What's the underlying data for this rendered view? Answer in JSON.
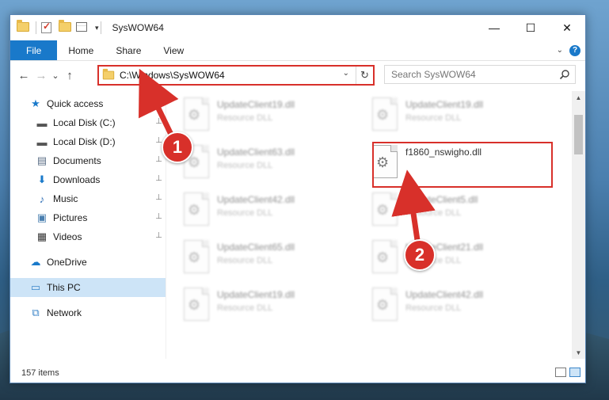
{
  "window": {
    "title": "SysWOW64",
    "controls": {
      "minimize": "—",
      "maximize": "☐",
      "close": "✕"
    }
  },
  "ribbon": {
    "tabs": [
      {
        "label": "File",
        "active": true
      },
      {
        "label": "Home"
      },
      {
        "label": "Share"
      },
      {
        "label": "View"
      }
    ],
    "accent": "#1979ca"
  },
  "navigation": {
    "back": "←",
    "forward": "→",
    "recent": "⌄",
    "up": "↑"
  },
  "address": {
    "path": "C:\\Windows\\SysWOW64",
    "dropdown": "⌄",
    "refresh": "↻"
  },
  "search": {
    "placeholder": "Search SysWOW64"
  },
  "sidebar": {
    "items": [
      {
        "label": "Quick access",
        "icon": "star-icon",
        "glyph": "★",
        "pinned": false
      },
      {
        "label": "Local Disk (C:)",
        "icon": "drive-icon",
        "glyph": "▬",
        "pinned": true
      },
      {
        "label": "Local Disk (D:)",
        "icon": "drive-icon",
        "glyph": "▬",
        "pinned": true
      },
      {
        "label": "Documents",
        "icon": "documents-icon",
        "glyph": "▤",
        "pinned": true
      },
      {
        "label": "Downloads",
        "icon": "download-icon",
        "glyph": "⬇",
        "pinned": true
      },
      {
        "label": "Music",
        "icon": "music-icon",
        "glyph": "♪",
        "pinned": true
      },
      {
        "label": "Pictures",
        "icon": "pictures-icon",
        "glyph": "▣",
        "pinned": true
      },
      {
        "label": "Videos",
        "icon": "videos-icon",
        "glyph": "▦",
        "pinned": true
      },
      {
        "label": "OneDrive",
        "icon": "cloud-icon",
        "glyph": "☁",
        "pinned": false
      },
      {
        "label": "This PC",
        "icon": "computer-icon",
        "glyph": "▭",
        "pinned": false,
        "selected": true
      },
      {
        "label": "Network",
        "icon": "network-icon",
        "glyph": "⧉",
        "pinned": false
      }
    ],
    "pin_glyph": "📌"
  },
  "files": [
    {
      "name": "UpdateClient19.dll",
      "type": "Resource DLL",
      "blurred": true
    },
    {
      "name": "UpdateClient19.dll",
      "type": "Resource DLL",
      "blurred": true
    },
    {
      "name": "UpdateClient63.dll",
      "type": "Resource DLL",
      "blurred": true
    },
    {
      "name": "f1860_nswigho.dll",
      "type": "",
      "blurred": false
    },
    {
      "name": "UpdateClient42.dll",
      "type": "Resource DLL",
      "blurred": true
    },
    {
      "name": "UpdateClient5.dll",
      "type": "Resource DLL",
      "blurred": true
    },
    {
      "name": "UpdateClient65.dll",
      "type": "Resource DLL",
      "blurred": true
    },
    {
      "name": "UpdateClient21.dll",
      "type": "Resource DLL",
      "blurred": true
    },
    {
      "name": "UpdateClient19.dll",
      "type": "Resource DLL",
      "blurred": true
    },
    {
      "name": "UpdateClient42.dll",
      "type": "Resource DLL",
      "blurred": true
    }
  ],
  "status": {
    "items_count": "157 items"
  },
  "annotations": {
    "markers": [
      "1",
      "2"
    ],
    "color": "#d8302a"
  }
}
